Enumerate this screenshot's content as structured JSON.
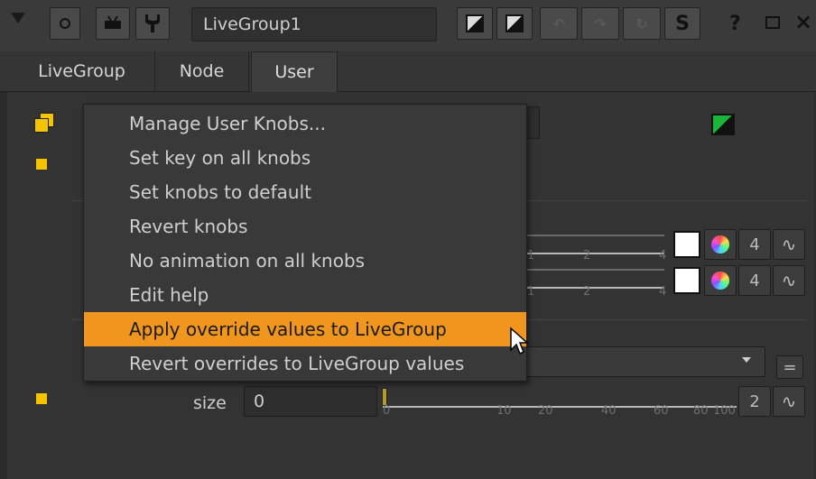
{
  "toolbar": {
    "node_name": "LiveGroup1",
    "s_label": "S",
    "help_label": "?"
  },
  "tabs": [
    {
      "label": "LiveGroup"
    },
    {
      "label": "Node"
    },
    {
      "label": "User"
    }
  ],
  "knobs": {
    "size_label": "size",
    "size_value": "0",
    "size_ticks": [
      "0",
      "10",
      "20",
      "40",
      "60",
      "80",
      "100"
    ],
    "size_channels": "2",
    "color_channels": "4",
    "color_ticks": [
      "1",
      "2",
      "4"
    ],
    "equals_label": "="
  },
  "context_menu": {
    "items": [
      {
        "label": "Manage User Knobs..."
      },
      {
        "label": "Set key on all knobs"
      },
      {
        "label": "Set knobs to default"
      },
      {
        "label": "Revert knobs"
      },
      {
        "label": "No animation on all knobs"
      },
      {
        "label": "Edit help"
      },
      {
        "label": "Apply override values to LiveGroup"
      },
      {
        "label": "Revert overrides to LiveGroup values"
      }
    ],
    "highlighted_index": 6,
    "highlight_color": "#f0961e"
  },
  "colors": {
    "accent_yellow": "#f5c400",
    "panel_bg": "#333333",
    "menu_bg": "#393939"
  }
}
